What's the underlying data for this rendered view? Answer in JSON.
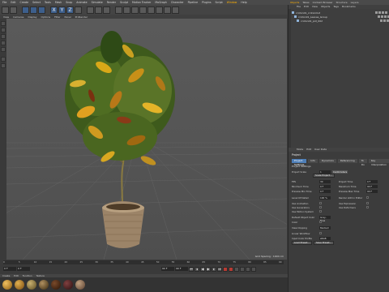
{
  "menubar": {
    "items": [
      "File",
      "Edit",
      "Create",
      "Select",
      "Tools",
      "Mesh",
      "Snap",
      "Animate",
      "Simulate",
      "Render",
      "Sculpt",
      "Motion Tracker",
      "MoGraph",
      "Character",
      "Pipeline",
      "Plugins",
      "Script",
      "Window",
      "Help"
    ],
    "highlight_index": 17
  },
  "toolbar": {
    "icons": [
      "undo-icon",
      "redo-icon",
      "sep",
      "move-icon",
      "scale-icon",
      "rotate-icon",
      "sep",
      "x-axis-icon",
      "y-axis-icon",
      "z-axis-icon",
      "coord-icon",
      "sep",
      "render-view-icon",
      "render-picture-icon",
      "render-settings-icon",
      "sep",
      "cube-icon",
      "spline-icon",
      "nurbs-icon",
      "array-icon",
      "deformer-icon",
      "scene-icon",
      "camera-icon",
      "light-icon"
    ],
    "axis_labels": [
      "X",
      "Y",
      "Z"
    ]
  },
  "viewport_menu": {
    "items": [
      "View",
      "Cameras",
      "Display",
      "Options",
      "Filter",
      "Panel",
      "ProRender"
    ]
  },
  "viewport": {
    "status": "Grid Spacing : 1000 cm"
  },
  "timeline": {
    "ticks": [
      "0",
      "5",
      "10",
      "15",
      "20",
      "25",
      "30",
      "35",
      "40",
      "45",
      "50",
      "55",
      "60",
      "65",
      "70",
      "75",
      "80",
      "85",
      "90"
    ],
    "start_frame": "0 F",
    "current_frame": "0 F",
    "end_frame": "90 F",
    "right_frame": "90 F"
  },
  "materials_bar": {
    "items": [
      "Create",
      "Edit",
      "Function",
      "Texture"
    ]
  },
  "materials": [
    {
      "color_a": "#f0c060",
      "color_b": "#8a5a10"
    },
    {
      "color_a": "#e0b050",
      "color_b": "#7a4a10"
    },
    {
      "color_a": "#c8b070",
      "color_b": "#5a4a20"
    },
    {
      "color_a": "#b09060",
      "color_b": "#3a2a10"
    },
    {
      "color_a": "#7a4a2a",
      "color_b": "#2a1408"
    },
    {
      "color_a": "#804040",
      "color_b": "#2a1010"
    },
    {
      "color_a": "#c0a080",
      "color_b": "#5a4030"
    }
  ],
  "right_top": {
    "items": [
      "Objects",
      "Takes",
      "Content Browser",
      "Structure",
      "Layers"
    ],
    "highlight_index": 0
  },
  "object_manager": {
    "menu": [
      "File",
      "Edit",
      "View",
      "Objects",
      "Tags",
      "Bookmarks"
    ],
    "rows": [
      {
        "name": "croton01_crotonOut"
      },
      {
        "name": "croton01_Leaves_Group"
      },
      {
        "name": "croton01_pot_002"
      }
    ]
  },
  "attributes": {
    "menu": [
      "Mode",
      "Edit",
      "User Data"
    ],
    "title": "Project",
    "tabs": [
      "Project Settings",
      "Info",
      "Dynamics",
      "Referencing",
      "To Do",
      "Key Interpolation",
      "Scene Nodes"
    ],
    "active_tab": 0,
    "section": "Project Settings",
    "fields_left": [
      {
        "label": "Project Scale",
        "value": "1",
        "unit": "Centimeters"
      },
      {
        "label": "FPS",
        "value": "30"
      },
      {
        "label": "Minimum Time",
        "value": "0 F"
      },
      {
        "label": "Preview Min Time",
        "value": "0 F"
      },
      {
        "label": "Level Of Detail",
        "value": "100 %"
      },
      {
        "label": "Use Animation",
        "value": ""
      },
      {
        "label": "Use Generators",
        "value": ""
      },
      {
        "label": "Use Motion System",
        "value": ""
      },
      {
        "label": "Default Object Color",
        "value": "Gray-Blue"
      },
      {
        "label": "Color",
        "value": ""
      },
      {
        "label": "View Clipping",
        "value": "Medium"
      },
      {
        "label": "Linear Workflow",
        "value": ""
      },
      {
        "label": "Input Color Profile",
        "value": "sRGB"
      }
    ],
    "fields_right": [
      {
        "label": "Project Time",
        "value": "0 F"
      },
      {
        "label": "Maximum Time",
        "value": "90 F"
      },
      {
        "label": "Preview Max Time",
        "value": "90 F"
      },
      {
        "label": "Render LOD in Editor",
        "value": ""
      },
      {
        "label": "Use Expression",
        "value": ""
      },
      {
        "label": "Use Deformers",
        "value": ""
      }
    ],
    "buttons": [
      "Load Preset...",
      "Save Preset..."
    ],
    "scale_button": "Scale Project..."
  }
}
